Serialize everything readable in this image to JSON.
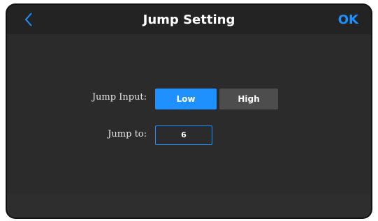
{
  "header": {
    "title": "Jump Setting",
    "ok_label": "OK",
    "back_icon": "chevron-left-icon"
  },
  "form": {
    "jump_input_label": "Jump Input:",
    "options": [
      "Low",
      "High"
    ],
    "selected_option": "Low",
    "jump_to_label": "Jump to:",
    "jump_to_value": "6"
  },
  "colors": {
    "accent": "#1e90ff",
    "background": "#2b2b2b",
    "header": "#232323",
    "inactive_button": "#4d4d4d",
    "text": "#ffffff"
  }
}
